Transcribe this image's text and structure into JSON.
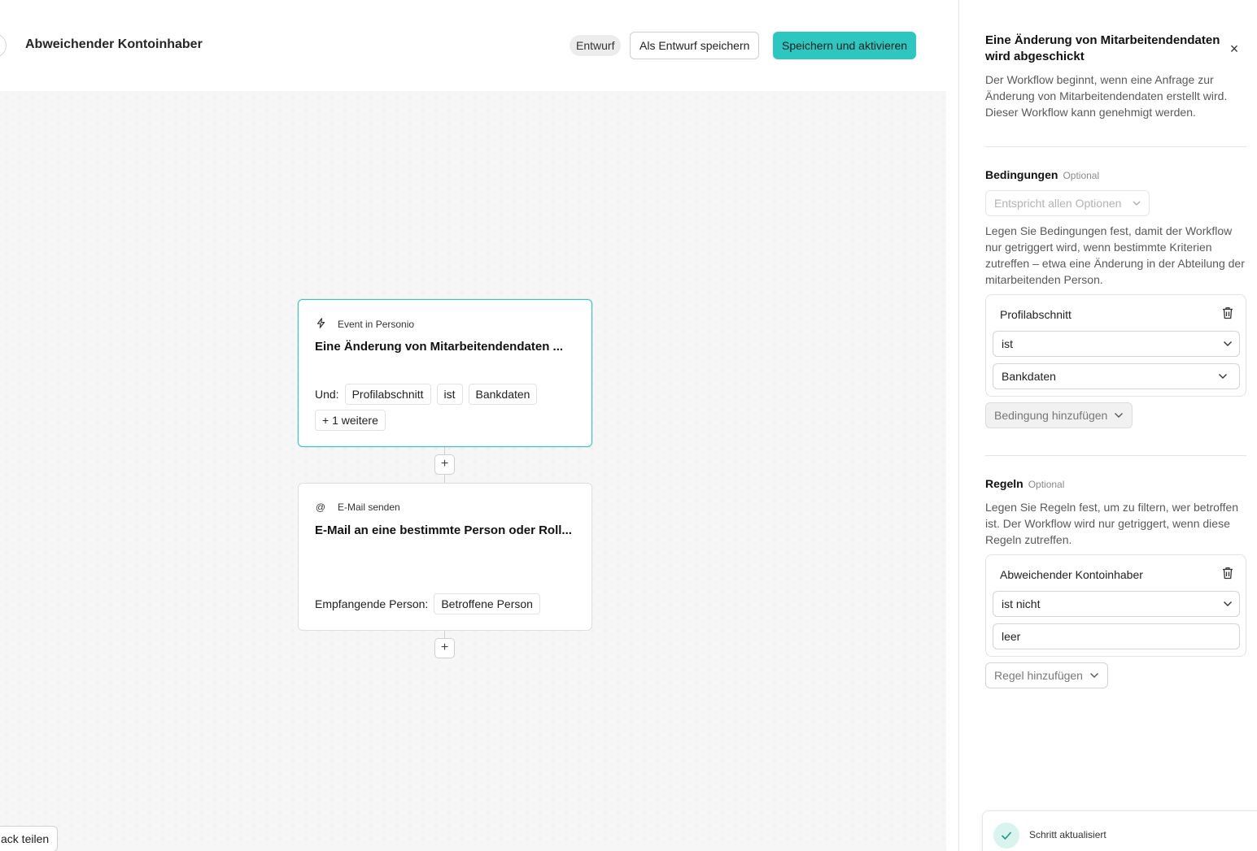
{
  "header": {
    "title": "Abweichender Kontoinhaber",
    "status": "Entwurf",
    "save_draft_label": "Als Entwurf speichern",
    "save_activate_label": "Speichern und aktivieren"
  },
  "canvas": {
    "trigger_node": {
      "meta": "Event in Personio",
      "icon": "lightning-icon",
      "title": "Eine Änderung von Mitarbeitendendaten ...",
      "prefix": "Und:",
      "chips": [
        "Profilabschnitt",
        "ist",
        "Bankdaten"
      ],
      "more": "+ 1 weitere"
    },
    "email_node": {
      "meta": "E-Mail senden",
      "icon": "at-icon",
      "title": "E-Mail an eine bestimmte Person oder Roll...",
      "recipient_label": "Empfangende Person:",
      "recipient_value": "Betroffene Person"
    },
    "plus_label": "+",
    "feedback_label": "ack teilen"
  },
  "panel": {
    "title": "Eine Änderung von Mitarbeitendendaten wird abgeschickt",
    "close_icon": "×",
    "description": "Der Workflow beginnt, wenn eine Anfrage zur Änderung von Mitarbeitendendaten erstellt wird. Dieser Workflow kann genehmigt werden.",
    "conditions": {
      "heading": "Bedingungen",
      "optional": "Optional",
      "match_select": "Entspricht allen Optionen",
      "description": "Legen Sie Bedingungen fest, damit der Workflow nur getriggert wird, wenn bestimmte Kriterien zutreffen – etwa eine Änderung in der Abteilung der mitarbeitenden Person.",
      "card": {
        "label": "Profilabschnitt",
        "operator": "ist",
        "value": "Bankdaten"
      },
      "add_label": "Bedingung hinzufügen"
    },
    "rules": {
      "heading": "Regeln",
      "optional": "Optional",
      "description": "Legen Sie Regeln fest, um zu filtern, wer betroffen ist. Der Workflow wird nur getriggert, wenn diese Regeln zutreffen.",
      "card": {
        "label": "Abweichender Kontoinhaber",
        "operator": "ist nicht",
        "value": "leer"
      },
      "add_label": "Regel hinzufügen"
    }
  },
  "toast": {
    "icon": "check-icon",
    "text": "Schritt aktualisiert"
  },
  "colors": {
    "accent": "#2ec7bf",
    "selected_border": "#36c5c0"
  }
}
